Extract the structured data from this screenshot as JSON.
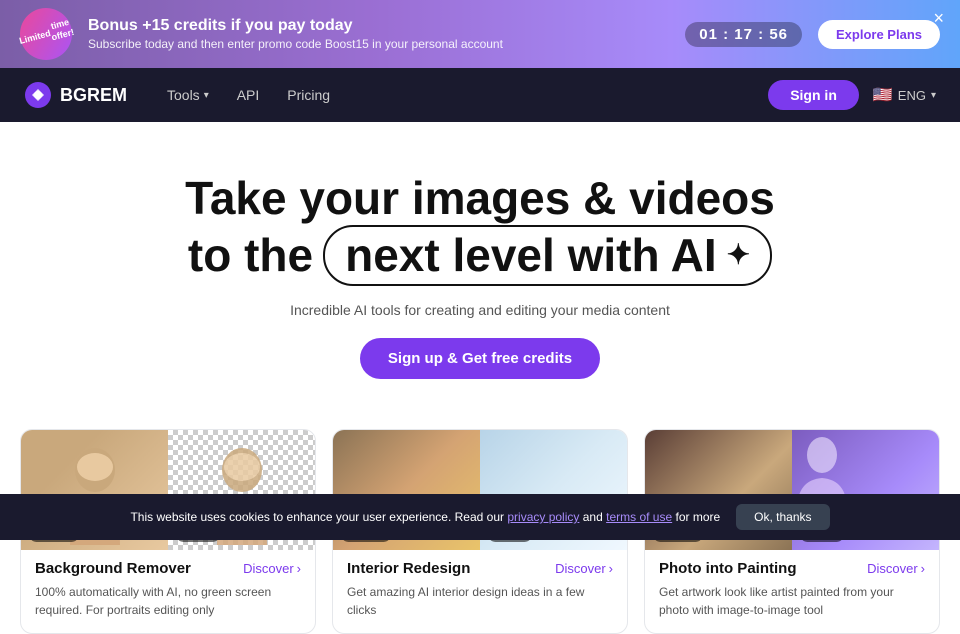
{
  "banner": {
    "badge_line1": "Limited",
    "badge_line2": "time offer!",
    "title": "Bonus +15 credits if you pay today",
    "subtitle": "Subscribe today and then enter promo code Boost15 in your personal account",
    "timer": "01 : 17 : 56",
    "cta_label": "Explore Plans",
    "close_label": "×"
  },
  "nav": {
    "logo_text": "BGREM",
    "tools_label": "Tools",
    "api_label": "API",
    "pricing_label": "Pricing",
    "signin_label": "Sign in",
    "lang_label": "ENG"
  },
  "hero": {
    "line1": "Take your images & videos",
    "line2_prefix": "to the",
    "line2_highlight": "next level with AI",
    "subtitle": "Incredible AI tools for creating and editing your media content",
    "cta_label": "Sign up & Get free credits"
  },
  "cards": [
    {
      "id": "background-remover",
      "title": "Background Remover",
      "discover": "Discover",
      "description": "100% automatically with AI, no green screen required. For portraits editing only",
      "label_orig": "Original",
      "label_result": "Result"
    },
    {
      "id": "interior-redesign",
      "title": "Interior Redesign",
      "discover": "Discover",
      "description": "Get amazing AI interior design ideas in a few clicks",
      "label_orig": "Original",
      "label_result": "Result"
    },
    {
      "id": "photo-into-painting",
      "title": "Photo into Painting",
      "discover": "Discover",
      "description": "Get artwork look like artist painted from your photo with image-to-image tool",
      "label_orig": "Original",
      "label_result": "Result"
    }
  ],
  "cookie": {
    "text": "This website uses cookies to enhance your user experience. Read our",
    "privacy_label": "privacy policy",
    "and_text": "and",
    "terms_label": "terms of use",
    "suffix": "for more",
    "ok_label": "Ok, thanks"
  }
}
